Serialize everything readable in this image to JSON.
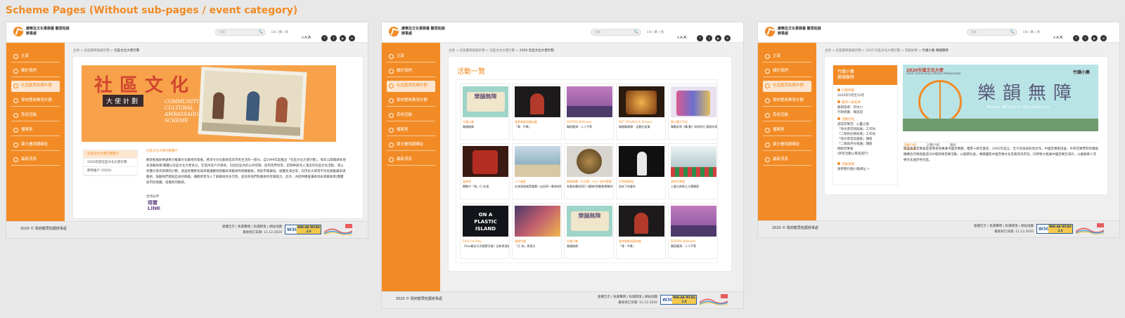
{
  "heading": "Scheme Pages (Without sub-pages / event category)",
  "header": {
    "org_name": "康樂及文化事務署 觀眾拓展辦事處",
    "search_placeholder": "搜尋",
    "search_icon": "🔍",
    "lang_switch": "EN | 繁 | 简",
    "font_sizes": [
      "A",
      "A",
      "A"
    ],
    "social": [
      "f",
      "t",
      "▶",
      "✉"
    ]
  },
  "nav": [
    {
      "label": "主頁",
      "icon": "home-icon"
    },
    {
      "label": "關於我們",
      "icon": "info-icon"
    },
    {
      "label": "社區觀眾拓展計劃",
      "icon": "community-icon"
    },
    {
      "label": "學校藝術教育計劃",
      "icon": "school-icon"
    },
    {
      "label": "其他活動",
      "icon": "calendar-icon"
    },
    {
      "label": "檔案室",
      "icon": "archive-icon"
    },
    {
      "label": "康文署相關網址",
      "icon": "link-icon"
    },
    {
      "label": "最新消息",
      "icon": "news-icon"
    }
  ],
  "footer": {
    "copyright": "2020 © 政府觀眾拓展辦事處",
    "links": "版權告示 | 免責聲明 | 私隱政策 | 網站地圖",
    "updated": "最後修訂日期: 11.12.2020",
    "w3c": "W3C",
    "wcag": "WAI-AA WCAG 2.0"
  },
  "page1": {
    "breadcrumb": {
      "prefix": "主頁 > 社區觀眾拓展計劃 > ",
      "current": "社區文化大使計劃"
    },
    "hero": {
      "title_zh": "社區文化",
      "subtitle_zh": "大使計劃",
      "title_en": "COMMUNITY CULTURAL AMBASSADOR SCHEME"
    },
    "submenu": [
      "社區文化大使計劃簡介",
      "2020年度社區文化大使計劃",
      "節目推介 (2020)"
    ],
    "intro_title": "社區文化大使計劃簡介",
    "intro_text": "觀眾拓展辦事處致力推廣文化藝術的發展，務求令文化藝術成為市民生活的一部分。自1999年起推出「社區文化大使計劃」，每年公開邀請本地表演藝術家/團體以社區文化大使身分，在室內及戶外場地，包括社區內的公共空間、屋邨及學校等，定期舉辦深入淺出的社區文化活動，或以各種大眾為目標的計劃，透過各種教育與導賞讓觀眾接觸表演藝術和視覺藝術，例如市集舞蹈、展覽及演出等，向市民大眾或不同社群推廣表演藝術，鼓勵他們發掘自身的興趣，讓觀眾更深入了解藝術的多元性，並培育他們對藝術的欣賞能力。此外，亦提供機會讓本地表演藝術家/團體與市民接觸，培養新的觀眾。",
    "partner_label": "合作伙伴",
    "partner_logo": "得寶 LINK"
  },
  "page2": {
    "breadcrumb": {
      "prefix": "主頁 > 社區觀眾拓展計劃 > 社區文化大使計劃 > ",
      "current": "2020 社區文化大使計劃"
    },
    "grid_title": "活動一覽",
    "activities": [
      {
        "category": "竹韻小集",
        "title": "樂韻無障",
        "art": "scroll"
      },
      {
        "category": "香港粵劇演藝協會",
        "title": "「粵 · 中華」",
        "art": "opera"
      },
      {
        "category": "SOFDAS Ballroom",
        "title": "舞蹈匯演：人人平等",
        "art": "dance"
      },
      {
        "category": "R&T (Rhythm & Tempo)",
        "title": "踢踏舞劇場 – 足動社區情",
        "art": "tap"
      },
      {
        "category": "鄧小蘭工作坊",
        "title": "舞動家常《舞·動》與你同行·藝術的奇妙在於大家的參與",
        "art": "stage"
      },
      {
        "category": "風車草",
        "title": "舞動中「粵」行 外語",
        "art": "opera2"
      },
      {
        "category": "二十聲部",
        "title": "在海灣邊感受聲響—自由享一晚海灣電影",
        "art": "beach"
      },
      {
        "category": "無極樂團 / 天台戲 / 小白 / 創作舞團",
        "title": "有聲有畫與同行 (聲線X我動態實驗作品)",
        "art": "gong"
      },
      {
        "category": "7A班戲劇組",
        "title": "彩虹下的童年",
        "art": "street"
      },
      {
        "category": "香港文學館",
        "title": "火鳳大劍地之大團圓版",
        "art": "parade"
      },
      {
        "category": "Zeal Cre Play",
        "title": "《Sou都計天洋塑膠浮島》全新表演設計項目工作坊",
        "art": "island"
      },
      {
        "category": "劇場空間",
        "title": "「天 地」表演光",
        "art": "theatre"
      },
      {
        "category": "竹韻小集",
        "title": "樂韻無障",
        "art": "scroll2"
      },
      {
        "category": "香港粵劇演藝協會",
        "title": "「粵 · 中華」",
        "art": "opera3"
      },
      {
        "category": "SOFDAS Ballroom",
        "title": "舞蹈匯演：人人平等",
        "art": "dance2"
      }
    ]
  },
  "page3": {
    "breadcrumb": {
      "prefix": "主頁 > 社區觀眾拓展計劃 > 2020 社區文化大使計劃 > 活動詳情 > ",
      "current": "竹韻小集 樂韻無障"
    },
    "event": {
      "org": "竹韻小集",
      "title": "樂韻無障",
      "dates_label": "計劃時期",
      "dates": "2020年5月至12月",
      "leader_label": "製作人員名單",
      "leader": "藝術指導：何文川\n行政統籌：陳思諾",
      "venue_label": "活動包括",
      "venues": "認認音樂堂：心靈之歌\n「地水南音唱與展」工作坊\n「二胡色彩教知我」工作坊\n「地水南音認識會」講座\n「二胡與月光夜曲」講座\n網絡音樂會\n(所有活動以粵語進行)",
      "more_label": "活動詳情",
      "more": "請參閱竹韻小集網址 ↗"
    },
    "banner": {
      "top": "2020社區文化大使",
      "sub": "2020 Community Cultural Ambassador",
      "title": "樂韻無障",
      "subtitle_en": "Music Without Boundaries",
      "brand": "竹韻小集"
    },
    "tabs": [
      "活動介紹",
      "計劃介紹",
      "圖片"
    ],
    "description": "學習香港音樂會是香港本地專業中國音樂團，積累十餘年歷史，2002年成立。至今先後與各地合作，中國音樂家協會，中央音樂學院等權威機構合作舉辦超過300場各類音樂活動，以服務社會，傳揚優質中國音樂文化及教育為宗旨，同時致力拓展中國音樂至海外，以推動華人音樂文化遍步各社區。"
  }
}
